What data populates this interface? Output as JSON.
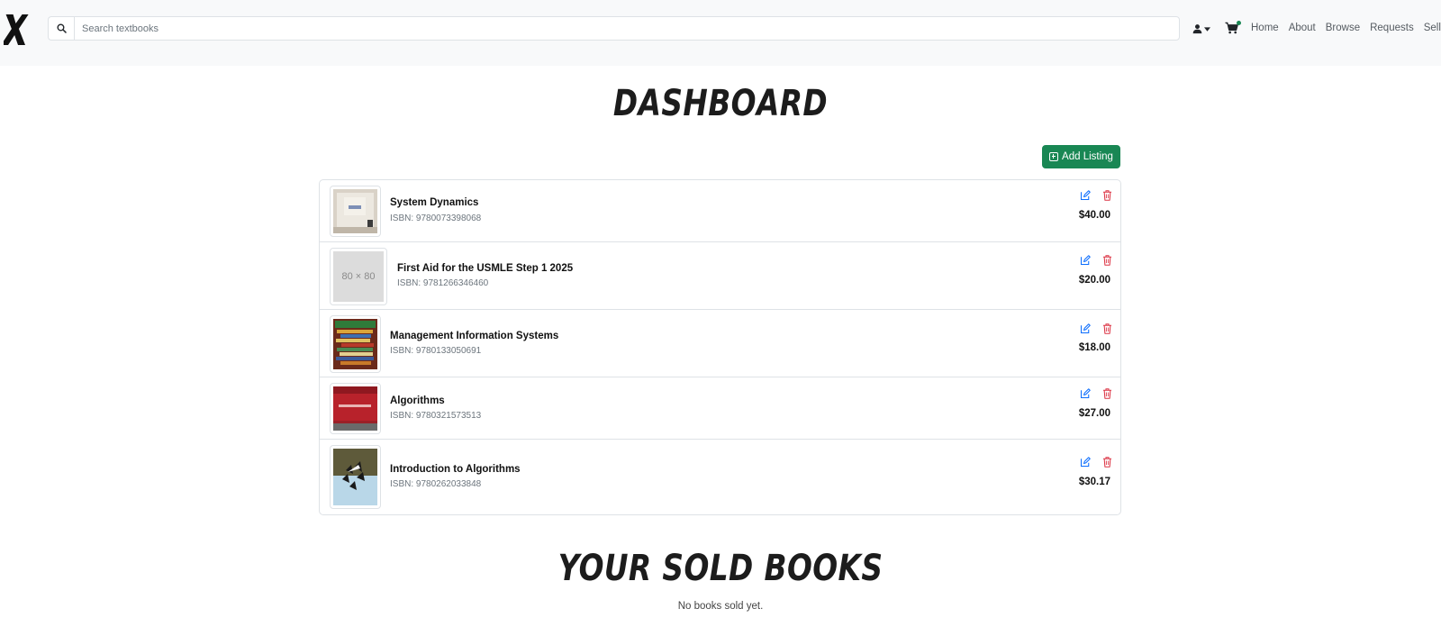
{
  "nav": {
    "search_placeholder": "Search textbooks",
    "links": [
      "Home",
      "About",
      "Browse",
      "Requests",
      "Sell"
    ]
  },
  "dashboard": {
    "title": "Dashboard",
    "add_listing_label": "Add Listing",
    "listings": [
      {
        "title": "System Dynamics",
        "isbn": "ISBN: 9780073398068",
        "price": "$40.00"
      },
      {
        "title": "First Aid for the USMLE Step 1 2025",
        "isbn": "ISBN: 9781266346460",
        "price": "$20.00",
        "placeholder_label": "80 × 80"
      },
      {
        "title": "Management Information Systems",
        "isbn": "ISBN: 9780133050691",
        "price": "$18.00"
      },
      {
        "title": "Algorithms",
        "isbn": "ISBN: 9780321573513",
        "price": "$27.00"
      },
      {
        "title": "Introduction to Algorithms",
        "isbn": "ISBN: 9780262033848",
        "price": "$30.17"
      }
    ]
  },
  "sold": {
    "title": "Your Sold Books",
    "empty_message": "No books sold yet."
  },
  "colors": {
    "accent_green": "#198754",
    "edit_blue": "#0d6efd",
    "delete_red": "#dc3545",
    "navbar_bg": "#f8f9fa"
  }
}
